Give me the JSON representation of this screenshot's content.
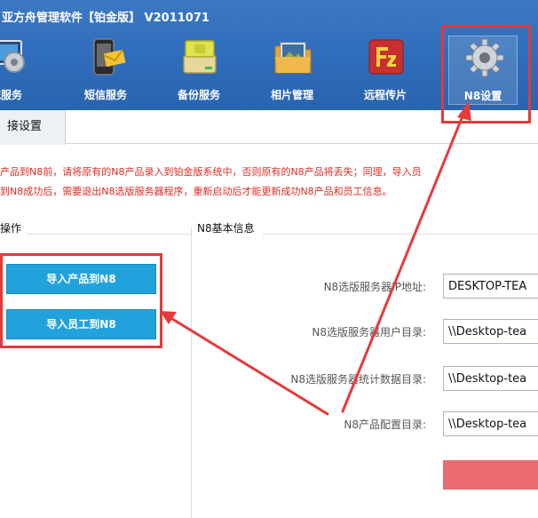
{
  "app": {
    "title": "亚方舟管理软件【铂金版】 V2011071"
  },
  "toolbar": {
    "items": [
      {
        "label": "统服务",
        "icon": "monitor-gear-icon"
      },
      {
        "label": "短信服务",
        "icon": "phone-message-icon"
      },
      {
        "label": "备份服务",
        "icon": "usb-drive-icon"
      },
      {
        "label": "相片管理",
        "icon": "photo-folder-icon"
      },
      {
        "label": "远程传片",
        "icon": "filezilla-icon"
      },
      {
        "label": "N8设置",
        "icon": "settings-gear-icon"
      }
    ],
    "active": "N8设置"
  },
  "tabs": [
    {
      "label": "接设置"
    }
  ],
  "notice": {
    "line1": "产品到N8前，请将原有的N8产品录入到铂金版系统中，否则原有的N8产品将丢失；同理，导入员",
    "line2": "到N8成功后，需要退出N8选版服务器程序，重新启动后才能更新成功N8产品和员工信息。",
    "color": "#e02a24"
  },
  "left_panel": {
    "title": "操作",
    "buttons": [
      {
        "label": "导入产品到N8"
      },
      {
        "label": "导入员工到N8"
      }
    ]
  },
  "right_panel": {
    "title": "N8基本信息",
    "fields": [
      {
        "label": "N8选版服务器IP地址:",
        "value": "DESKTOP-TEA"
      },
      {
        "label": "N8选版服务器用户目录:",
        "value": "\\\\Desktop-tea"
      },
      {
        "label": "N8选版服务器统计数据目录:",
        "value": "\\\\Desktop-tea"
      },
      {
        "label": "N8产品配置目录:",
        "value": "\\\\Desktop-tea"
      }
    ]
  },
  "colors": {
    "header": "#2f6cb9",
    "button": "#21a2dd",
    "highlight": "#e03a3a",
    "action": "#ec6b72"
  }
}
